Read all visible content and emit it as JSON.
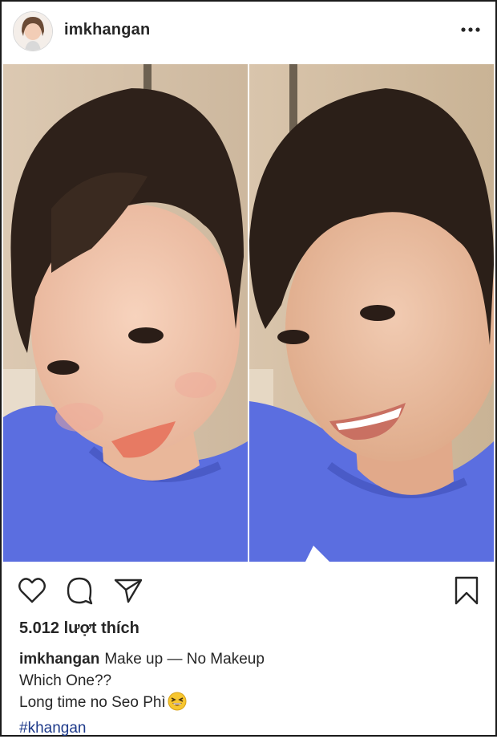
{
  "post": {
    "username": "imkhangan",
    "likes_text": "5.012 lượt thích",
    "caption_username": "imkhangan",
    "caption_line1": "Make up — No Makeup",
    "caption_line2": "Which One??",
    "caption_line3": "Long time no Seo Phì",
    "hashtag": "#khangan"
  },
  "icons": {
    "more": "more-options-icon",
    "like": "heart-icon",
    "comment": "comment-icon",
    "share": "send-icon",
    "save": "bookmark-icon",
    "emoji": "grinning-squinting-face-emoji"
  },
  "colors": {
    "text": "#262626",
    "hashtag": "#1e3a8a",
    "shirt": "#5b6ee0",
    "border": "#1a1a1a"
  }
}
